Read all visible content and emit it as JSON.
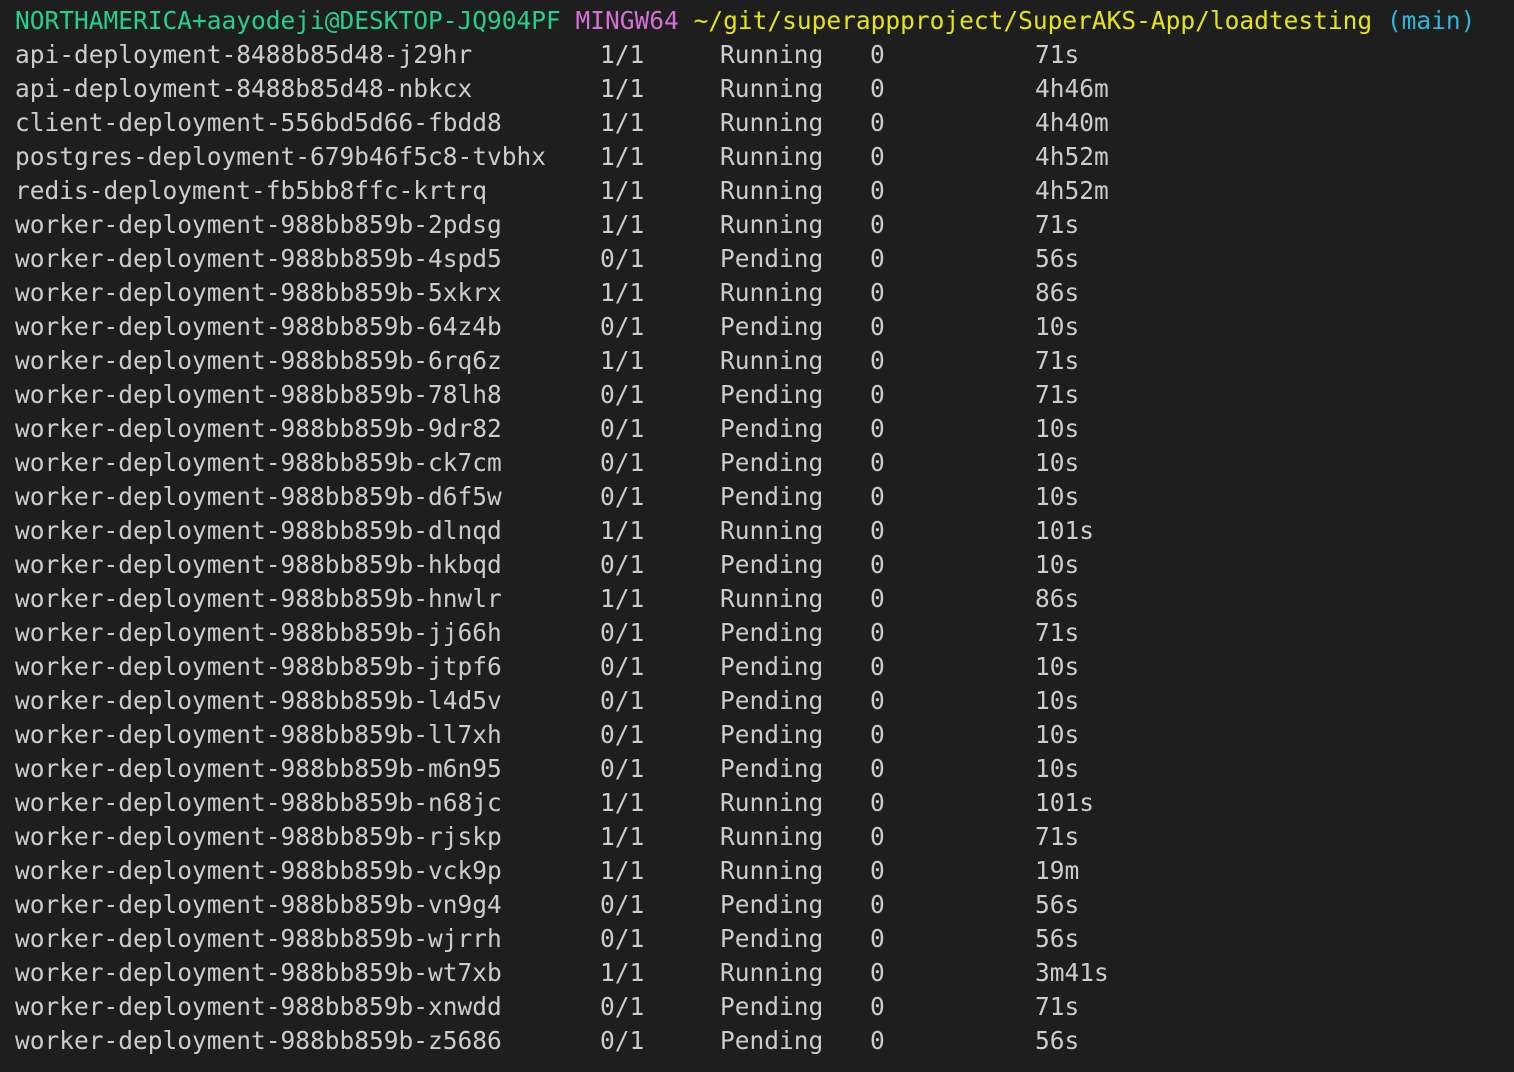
{
  "prompt": {
    "user_host": "NORTHAMERICA+aayodeji@DESKTOP-JQ904PF",
    "system": "MINGW64",
    "path": "~/git/superappproject/SuperAKS-App/loadtesting",
    "branch": "(main)"
  },
  "pods": [
    {
      "name": "api-deployment-8488b85d48-j29hr",
      "ready": "1/1",
      "status": "Running",
      "restarts": "0",
      "age": "71s"
    },
    {
      "name": "api-deployment-8488b85d48-nbkcx",
      "ready": "1/1",
      "status": "Running",
      "restarts": "0",
      "age": "4h46m"
    },
    {
      "name": "client-deployment-556bd5d66-fbdd8",
      "ready": "1/1",
      "status": "Running",
      "restarts": "0",
      "age": "4h40m"
    },
    {
      "name": "postgres-deployment-679b46f5c8-tvbhx",
      "ready": "1/1",
      "status": "Running",
      "restarts": "0",
      "age": "4h52m"
    },
    {
      "name": "redis-deployment-fb5bb8ffc-krtrq",
      "ready": "1/1",
      "status": "Running",
      "restarts": "0",
      "age": "4h52m"
    },
    {
      "name": "worker-deployment-988bb859b-2pdsg",
      "ready": "1/1",
      "status": "Running",
      "restarts": "0",
      "age": "71s"
    },
    {
      "name": "worker-deployment-988bb859b-4spd5",
      "ready": "0/1",
      "status": "Pending",
      "restarts": "0",
      "age": "56s"
    },
    {
      "name": "worker-deployment-988bb859b-5xkrx",
      "ready": "1/1",
      "status": "Running",
      "restarts": "0",
      "age": "86s"
    },
    {
      "name": "worker-deployment-988bb859b-64z4b",
      "ready": "0/1",
      "status": "Pending",
      "restarts": "0",
      "age": "10s"
    },
    {
      "name": "worker-deployment-988bb859b-6rq6z",
      "ready": "1/1",
      "status": "Running",
      "restarts": "0",
      "age": "71s"
    },
    {
      "name": "worker-deployment-988bb859b-78lh8",
      "ready": "0/1",
      "status": "Pending",
      "restarts": "0",
      "age": "71s"
    },
    {
      "name": "worker-deployment-988bb859b-9dr82",
      "ready": "0/1",
      "status": "Pending",
      "restarts": "0",
      "age": "10s"
    },
    {
      "name": "worker-deployment-988bb859b-ck7cm",
      "ready": "0/1",
      "status": "Pending",
      "restarts": "0",
      "age": "10s"
    },
    {
      "name": "worker-deployment-988bb859b-d6f5w",
      "ready": "0/1",
      "status": "Pending",
      "restarts": "0",
      "age": "10s"
    },
    {
      "name": "worker-deployment-988bb859b-dlnqd",
      "ready": "1/1",
      "status": "Running",
      "restarts": "0",
      "age": "101s"
    },
    {
      "name": "worker-deployment-988bb859b-hkbqd",
      "ready": "0/1",
      "status": "Pending",
      "restarts": "0",
      "age": "10s"
    },
    {
      "name": "worker-deployment-988bb859b-hnwlr",
      "ready": "1/1",
      "status": "Running",
      "restarts": "0",
      "age": "86s"
    },
    {
      "name": "worker-deployment-988bb859b-jj66h",
      "ready": "0/1",
      "status": "Pending",
      "restarts": "0",
      "age": "71s"
    },
    {
      "name": "worker-deployment-988bb859b-jtpf6",
      "ready": "0/1",
      "status": "Pending",
      "restarts": "0",
      "age": "10s"
    },
    {
      "name": "worker-deployment-988bb859b-l4d5v",
      "ready": "0/1",
      "status": "Pending",
      "restarts": "0",
      "age": "10s"
    },
    {
      "name": "worker-deployment-988bb859b-ll7xh",
      "ready": "0/1",
      "status": "Pending",
      "restarts": "0",
      "age": "10s"
    },
    {
      "name": "worker-deployment-988bb859b-m6n95",
      "ready": "0/1",
      "status": "Pending",
      "restarts": "0",
      "age": "10s"
    },
    {
      "name": "worker-deployment-988bb859b-n68jc",
      "ready": "1/1",
      "status": "Running",
      "restarts": "0",
      "age": "101s"
    },
    {
      "name": "worker-deployment-988bb859b-rjskp",
      "ready": "1/1",
      "status": "Running",
      "restarts": "0",
      "age": "71s"
    },
    {
      "name": "worker-deployment-988bb859b-vck9p",
      "ready": "1/1",
      "status": "Running",
      "restarts": "0",
      "age": "19m"
    },
    {
      "name": "worker-deployment-988bb859b-vn9g4",
      "ready": "0/1",
      "status": "Pending",
      "restarts": "0",
      "age": "56s"
    },
    {
      "name": "worker-deployment-988bb859b-wjrrh",
      "ready": "0/1",
      "status": "Pending",
      "restarts": "0",
      "age": "56s"
    },
    {
      "name": "worker-deployment-988bb859b-wt7xb",
      "ready": "1/1",
      "status": "Running",
      "restarts": "0",
      "age": "3m41s"
    },
    {
      "name": "worker-deployment-988bb859b-xnwdd",
      "ready": "0/1",
      "status": "Pending",
      "restarts": "0",
      "age": "71s"
    },
    {
      "name": "worker-deployment-988bb859b-z5686",
      "ready": "0/1",
      "status": "Pending",
      "restarts": "0",
      "age": "56s"
    }
  ]
}
